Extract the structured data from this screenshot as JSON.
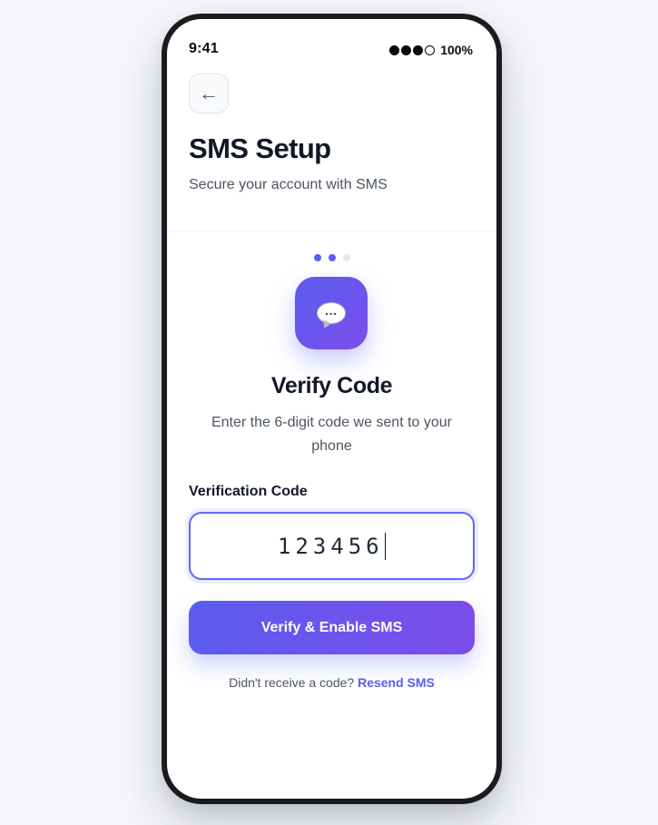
{
  "status_bar": {
    "time": "9:41",
    "signal_filled": 3,
    "signal_total": 4,
    "battery": "100%"
  },
  "header": {
    "back_icon": "←",
    "title": "SMS Setup",
    "subtitle": "Secure your account with SMS"
  },
  "progress": {
    "current_step": 2,
    "total_steps": 3
  },
  "icon": {
    "name": "speech-bubble-icon",
    "glyph": "…"
  },
  "verify": {
    "title": "Verify Code",
    "description": "Enter the 6-digit code we sent to your phone"
  },
  "form": {
    "code_label": "Verification Code",
    "code_value": "123456"
  },
  "actions": {
    "submit_label": "Verify & Enable SMS",
    "resend_prompt": "Didn't receive a code?",
    "resend_link": "Resend SMS"
  },
  "colors": {
    "accent": "#5b5cf0",
    "accent_end": "#7c4dea",
    "title_text": "#111827",
    "body_text": "#4b5563"
  }
}
